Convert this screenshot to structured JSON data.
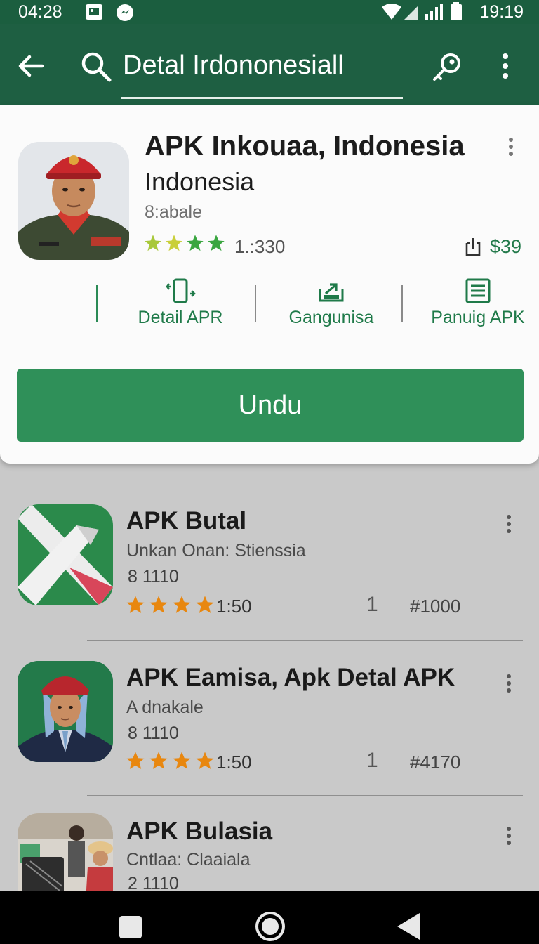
{
  "status_bar": {
    "time_left": "04:28",
    "time_right": "19:19"
  },
  "app_bar": {
    "search_text": "Detal Irdononesiall"
  },
  "featured": {
    "title_line1": "APK Inkouaa, Indonesia",
    "title_line2": "Indonesia",
    "subtitle": "8:abale",
    "rating_count": "1.:330",
    "price": "$39",
    "actions": [
      {
        "label": "Detail APR",
        "icon": "phone-rotate-icon"
      },
      {
        "label": "Gangunisa",
        "icon": "share-upload-icon"
      },
      {
        "label": "Panuig APK",
        "icon": "document-icon"
      }
    ],
    "download_label": "Undu"
  },
  "list": [
    {
      "title": "APK Butal",
      "subtitle": "Unkan Onan: Stienssia",
      "size": "8 1110",
      "rating": "1:50",
      "one": "1",
      "rank": "#1000"
    },
    {
      "title": "APK Eamisa, Apk Detal APK",
      "subtitle": "A dnakale",
      "size": "8 1110",
      "rating": "1:50",
      "one": "1",
      "rank": "#4170"
    },
    {
      "title": "APK Bulasia",
      "subtitle": "Cntlaa: Claaiala",
      "size": "2 1110"
    }
  ],
  "colors": {
    "primary": "#1e5f42",
    "accent": "#2f9059",
    "star_orange": "#e8870f",
    "star_green": "#3aa640"
  }
}
